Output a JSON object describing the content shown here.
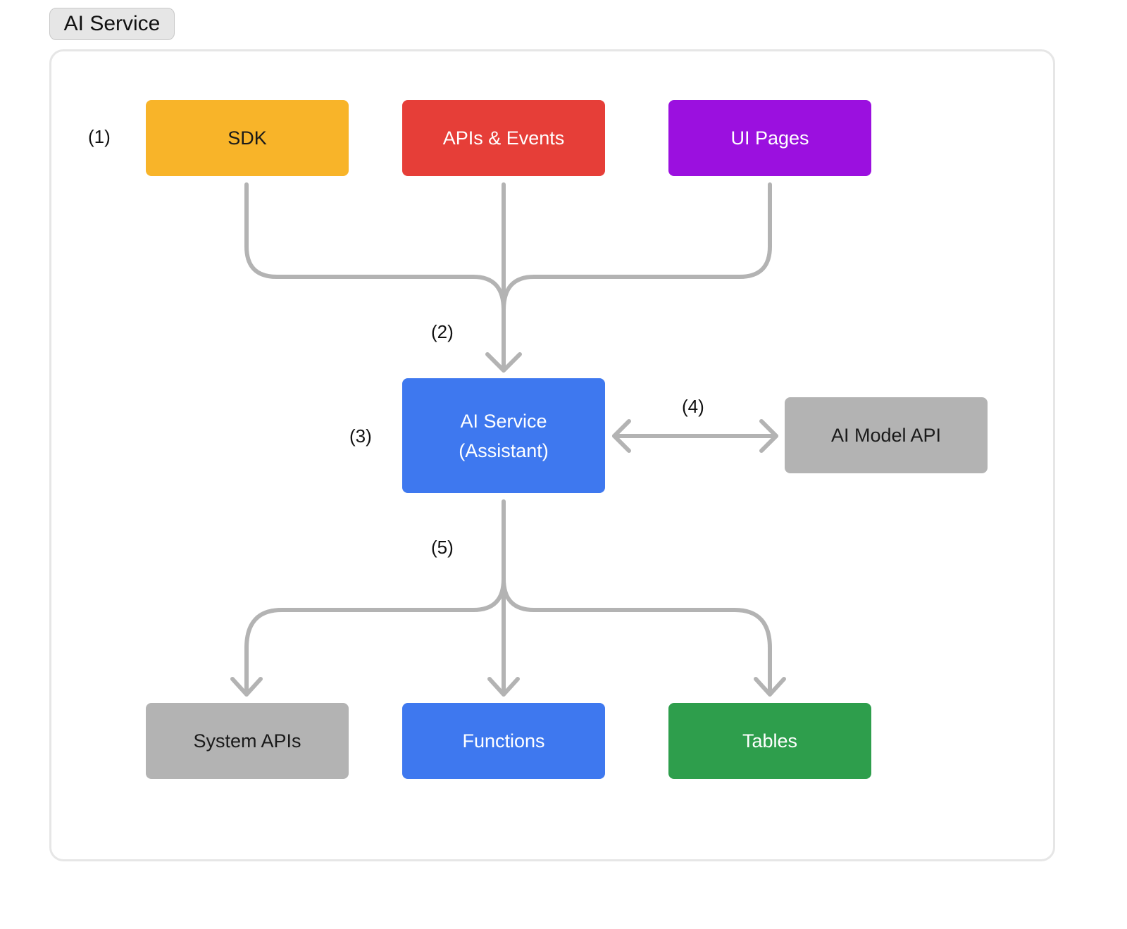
{
  "title": "AI Service",
  "colors": {
    "connector": "#b3b3b3",
    "frame_border": "#e6e6e6"
  },
  "nodes": {
    "sdk": {
      "label": "SDK",
      "bg": "#f8b429",
      "fg": "#1a1a1a"
    },
    "apis_events": {
      "label": "APIs & Events",
      "bg": "#e63e38",
      "fg": "#ffffff"
    },
    "ui_pages": {
      "label": "UI Pages",
      "bg": "#9b10df",
      "fg": "#ffffff"
    },
    "ai_service": {
      "label_line1": "AI Service",
      "label_line2": "(Assistant)",
      "bg": "#3e78ef",
      "fg": "#ffffff"
    },
    "ai_model_api": {
      "label": "AI Model API",
      "bg": "#b3b3b3",
      "fg": "#1a1a1a"
    },
    "system_apis": {
      "label": "System APIs",
      "bg": "#b3b3b3",
      "fg": "#1a1a1a"
    },
    "functions": {
      "label": "Functions",
      "bg": "#3e78ef",
      "fg": "#ffffff"
    },
    "tables": {
      "label": "Tables",
      "bg": "#2e9e4c",
      "fg": "#ffffff"
    }
  },
  "step_labels": {
    "s1": "(1)",
    "s2": "(2)",
    "s3": "(3)",
    "s4": "(4)",
    "s5": "(5)"
  }
}
